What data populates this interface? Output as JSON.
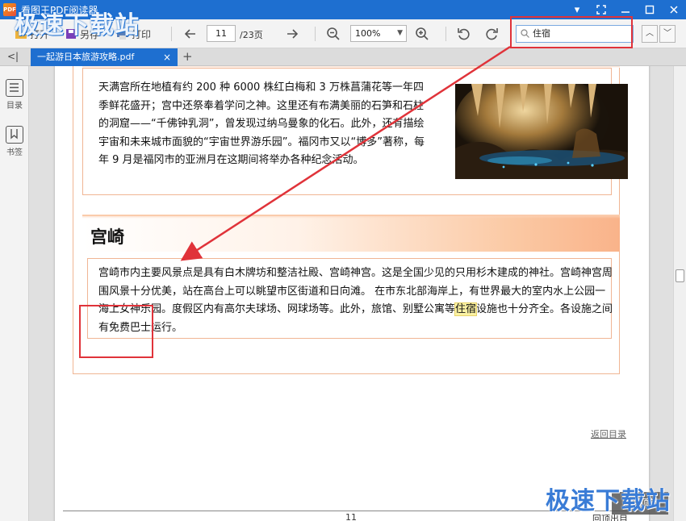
{
  "app": {
    "title": "看图王PDF阅读器",
    "icon_text": "PDF"
  },
  "window_buttons": [
    "chevron-down-icon",
    "fullscreen-icon",
    "minimize-icon",
    "maximize-icon",
    "close-icon"
  ],
  "watermark": {
    "text": "极速下载站"
  },
  "toolbar": {
    "open_label": "打开",
    "saveas_label": "另存",
    "print_label": "打印",
    "current_page": "11",
    "total_pages": "/23页",
    "zoom": "100%",
    "search_value": "住宿"
  },
  "tabs": {
    "doc_tab_label": "一起游日本旅游攻略.pdf",
    "close_symbol": "×",
    "new_symbol": "+",
    "collapse_symbol": "<|"
  },
  "sidebar": {
    "toc_label": "目录",
    "bookmarks_label": "书签"
  },
  "document": {
    "section1_text": "天满宫所在地植有约 200 种 6000 株红白梅和 3 万株菖蒲花等一年四季鲜花盛开；宫中还祭奉着学问之神。这里还有布满美丽的石笋和石柱的洞窟——“千佛钟乳洞”，曾发现过纳乌曼象的化石。此外，还有描绘宇宙和未来城市面貌的“宇宙世界游乐园”。福冈市又以“博多”著称，每年 9 月是福冈市的亚洲月在这期间将举办各种纪念活动。",
    "section2_title": "宫崎",
    "section2_before": "宫崎市内主要风景点是具有白木牌坊和整洁社殿、宫崎神宫。这是全国少见的只用杉木建成的神社。宫崎神宫周围风景十分优美，站在高台上可以眺望市区街道和日向滩。 在市东北部海岸上，有世界最大的室内水上公园一海上女神乐园。度假区内有高尔夫球场、网球场等。此外，旅馆、别墅公寓等",
    "section2_highlight": "住宿",
    "section2_after": "设施也十分齐全。各设施之间有免费巴士运行。",
    "back_link": "返回目录",
    "footer_page": "11",
    "footer_right": "回顶出目"
  },
  "back_to_top": "返回顶部",
  "colors": {
    "accent": "#1e6fd0",
    "annotation": "#e0333a",
    "highlight": "#fbf2a3",
    "frame": "#f0b594"
  }
}
